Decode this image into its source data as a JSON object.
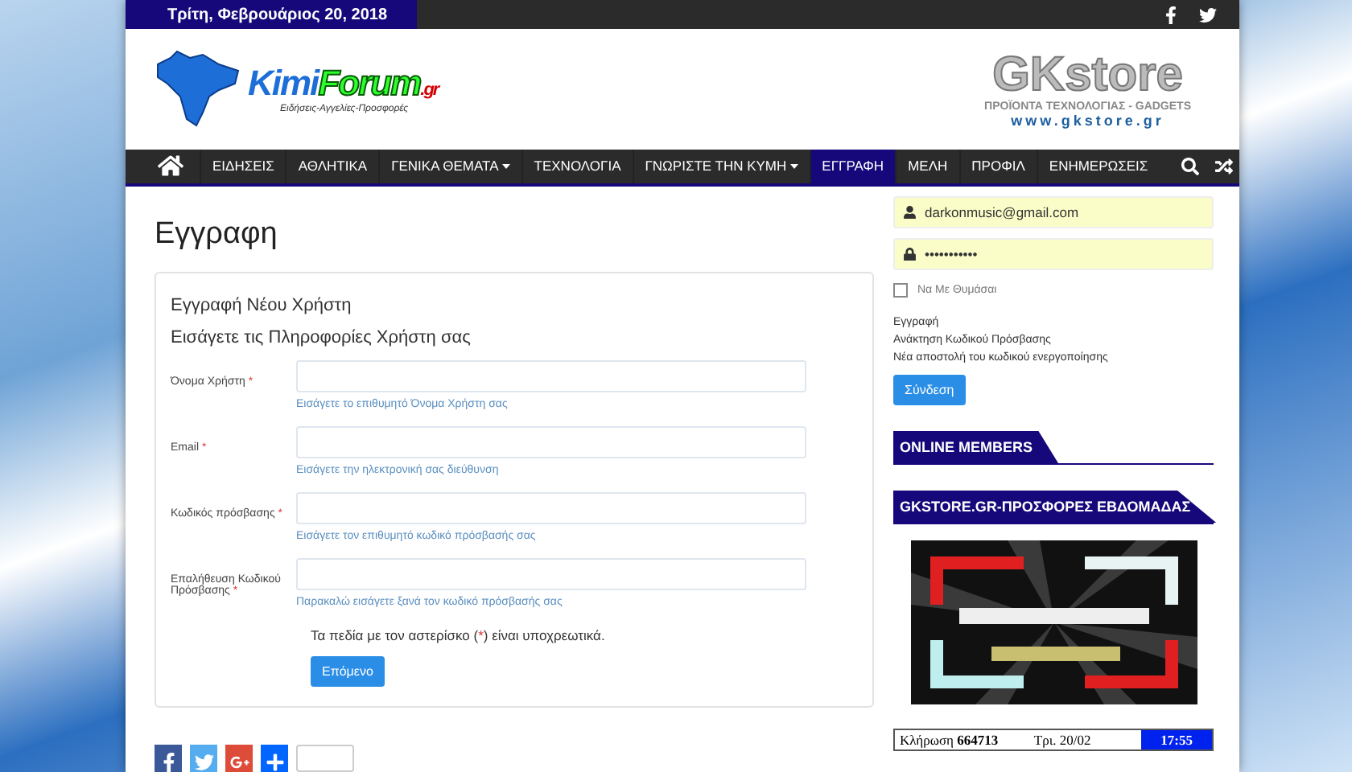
{
  "top_bar": {
    "date": "Τρίτη, Φεβρουάριος 20, 2018"
  },
  "header": {
    "logo": {
      "part_1": "Kimi",
      "part_2": "Forum",
      "part_3": ".gr",
      "tagline": "Ειδήσεις-Αγγελίες-Προσφορές"
    },
    "ad": {
      "name": "GKstore",
      "tagline": "ΠΡΟΪΟΝΤΑ ΤΕΧΝΟΛΟΓΙΑΣ - GADGETS",
      "url": "www.gkstore.gr"
    }
  },
  "nav": {
    "items": [
      {
        "label": "ΕΙΔΗΣΕΙΣ",
        "selected": false,
        "dropdown": false
      },
      {
        "label": "ΑΘΛΗΤΙΚΑ",
        "selected": false,
        "dropdown": false
      },
      {
        "label": "ΓΕΝΙΚΑ ΘΕΜΑΤΑ",
        "selected": false,
        "dropdown": true
      },
      {
        "label": "ΤΕΧΝΟΛΟΓΙΑ",
        "selected": false,
        "dropdown": false
      },
      {
        "label": "ΓΝΩΡΙΣΤΕ ΤΗΝ ΚΥΜΗ",
        "selected": false,
        "dropdown": true
      },
      {
        "label": "ΕΓΓΡΑΦΗ",
        "selected": true,
        "dropdown": false
      },
      {
        "label": "ΜΕΛΗ",
        "selected": false,
        "dropdown": false
      },
      {
        "label": "ΠΡΟΦΙΛ",
        "selected": false,
        "dropdown": false
      },
      {
        "label": "ΕΝΗΜΕΡΩΣΕΙΣ",
        "selected": false,
        "dropdown": false
      }
    ]
  },
  "page_title": "Εγγραφη",
  "form": {
    "heading": "Εγγραφή Νέου Χρήστη",
    "subheading": "Εισάγετε τις Πληροφορίες Χρήστη σας",
    "fields": [
      {
        "label": "Όνομα Χρήστη",
        "required": true,
        "hint": "Εισάγετε το επιθυμητό Όνομα Χρήστη σας"
      },
      {
        "label": "Email",
        "required": true,
        "hint": "Εισάγετε την ηλεκτρονική σας διεύθυνση"
      },
      {
        "label": "Κωδικός πρόσβασης",
        "required": true,
        "hint": "Εισάγετε τον επιθυμητό κωδικό πρόσβασής σας"
      },
      {
        "label": "Επαλήθευση Κωδικού Πρόσβασης",
        "required": true,
        "hint": "Παρακαλώ εισάγετε ξανά τον κωδικό πρόσβασής σας"
      }
    ],
    "note": {
      "before": "Τα πεδία με τον αστερίσκο (",
      "mark": "*",
      "after": ") είναι υποχρεωτικά."
    },
    "submit": "Επόμενο"
  },
  "login": {
    "username": "darkonmusic@gmail.com",
    "password": "•••••••••••",
    "remember": {
      "label": "Να Με Θυμάσαι",
      "checked": false
    },
    "links": [
      "Εγγραφή",
      "Ανάκτηση Κωδικού Πρόσβασης",
      "Νέα αποστολή του κωδικού ενεργοποίησης"
    ],
    "submit": "Σύνδεση"
  },
  "widgets": [
    {
      "title": "ONLINE MEMBERS"
    },
    {
      "title": "GKSTORE.GR-ΠΡΟΣΦΟΡΕΣ ΕΒΔΟΜΑΔΑΣ",
      "kind": "picture"
    }
  ],
  "lottery": {
    "label": "Κλήρωση",
    "number": "664713",
    "date": "Τρι. 20/02",
    "time": "17:55"
  }
}
